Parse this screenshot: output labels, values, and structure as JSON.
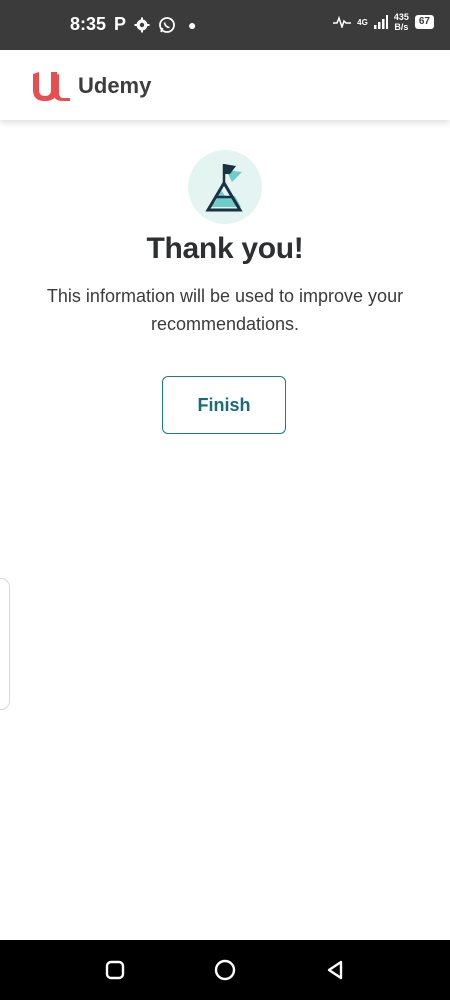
{
  "status_bar": {
    "time": "8:35",
    "notification_icons": [
      "parking-icon",
      "settings-icon",
      "whatsapp-icon",
      "dot-icon"
    ],
    "network_type": "4G",
    "net_speed_value": "435",
    "net_speed_unit": "B/s",
    "battery_level": "67"
  },
  "header": {
    "brand": "Udemy",
    "brand_color": "#e84e4f"
  },
  "main": {
    "icon": "flag-summit-icon",
    "title": "Thank you!",
    "subtitle": "This information will be used to improve your recommendations.",
    "finish_label": "Finish",
    "accent_color": "#1c7a8a"
  },
  "nav_bar": {
    "buttons": [
      "recents-button",
      "home-button",
      "back-button"
    ]
  }
}
